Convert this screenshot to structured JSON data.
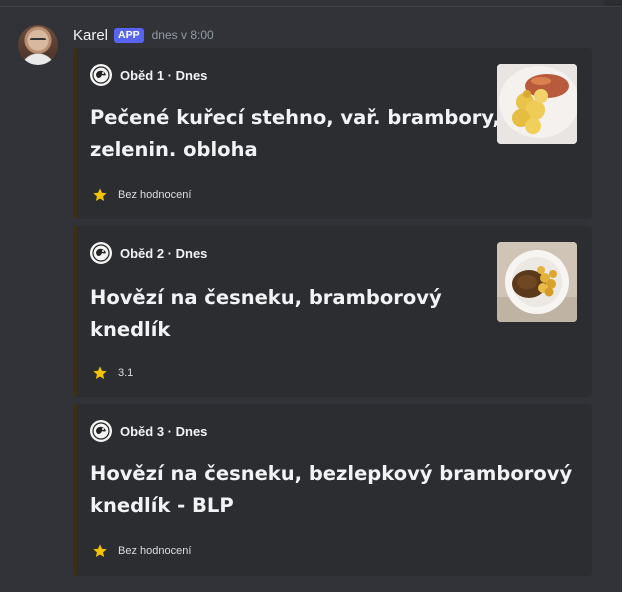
{
  "message": {
    "username": "Karel",
    "badge": "APP",
    "timestamp": "dnes v 8:00"
  },
  "embeds": [
    {
      "author": "Oběd 1 · Dnes",
      "title_line1": "Pečené kuřecí stehno, vař. brambory,",
      "title_line2": "zelenin. obloha",
      "rating": "Bez hodnocení",
      "image": "roast-chicken-potatoes-thumbnail"
    },
    {
      "author": "Oběd 2 · Dnes",
      "title_line1": "Hovězí na česneku, bramborový",
      "title_line2": "knedlík",
      "rating": "3.1",
      "image": "beef-garlic-dumpling-thumbnail"
    },
    {
      "author": "Oběd 3 · Dnes",
      "title_line1": "Hovězí na česneku, bezlepkový bramborový",
      "title_line2": "knedlík - BLP",
      "rating": "Bez hodnocení"
    }
  ],
  "colors": {
    "background": "#313338",
    "embed_background": "#2b2d31",
    "embed_border": "#3b2e14",
    "badge": "#5865f2",
    "star": "#f5c400"
  },
  "icons": {
    "author": "restaurant-logo-icon",
    "rating": "star-icon"
  }
}
